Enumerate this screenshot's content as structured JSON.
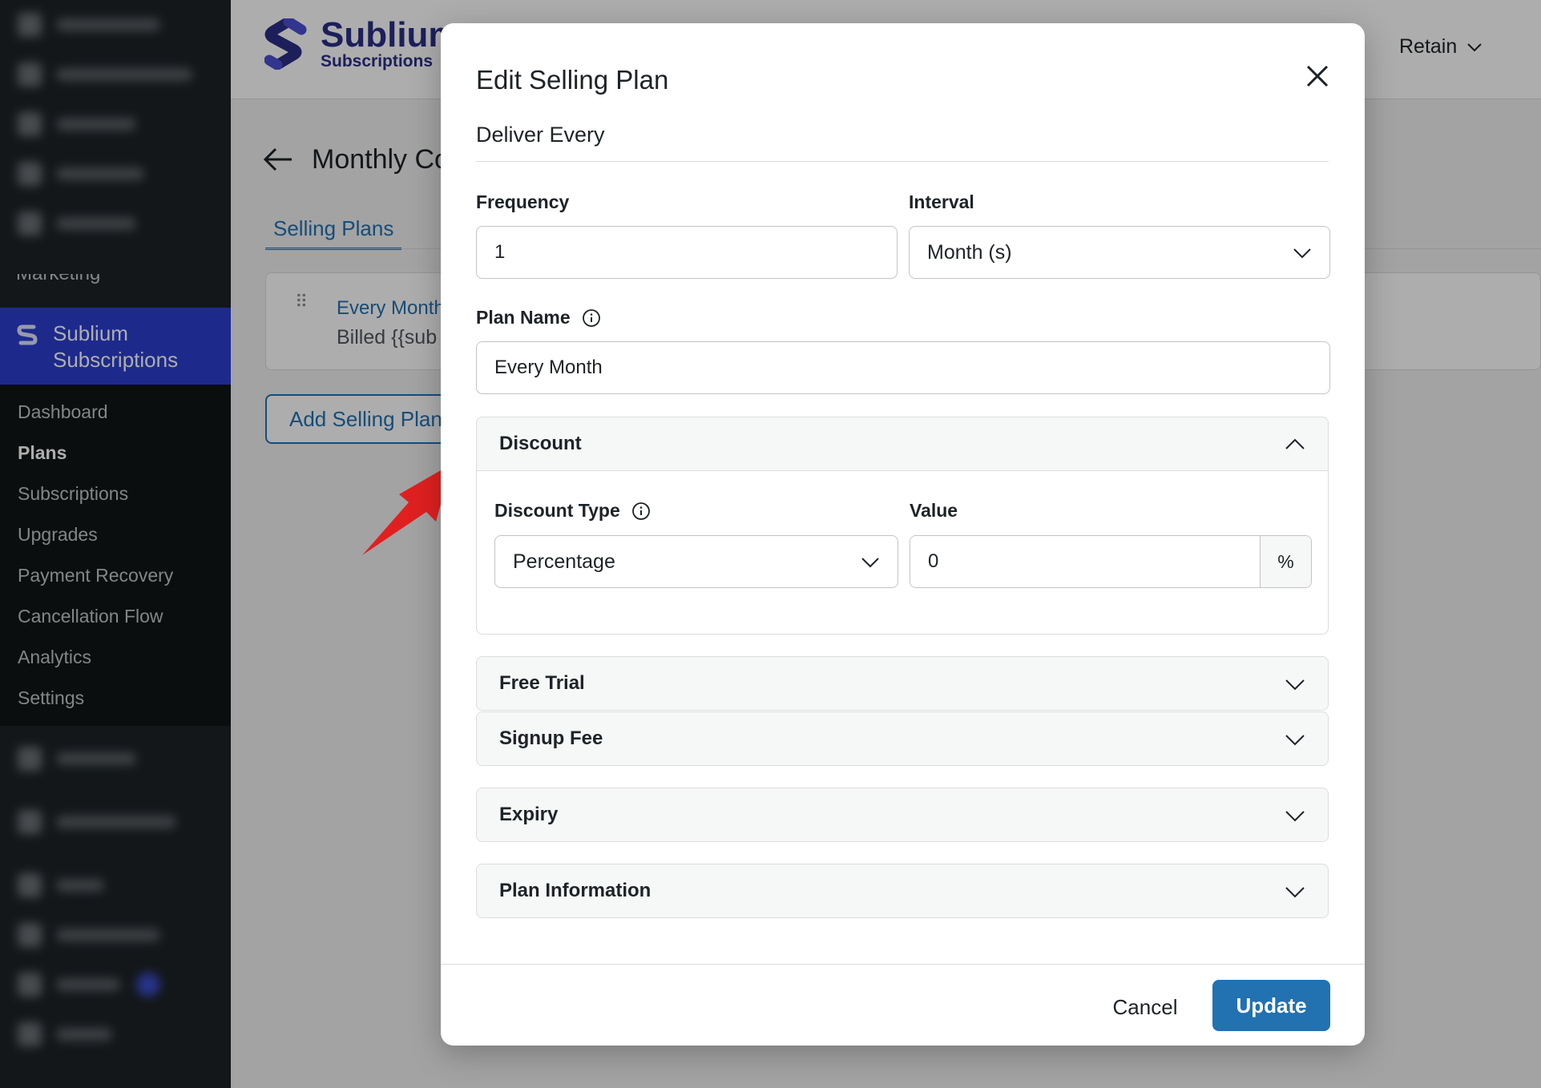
{
  "sidebar": {
    "partial_item": "Marketing",
    "active_plugin": {
      "line1": "Sublium",
      "line2": "Subscriptions"
    },
    "submenu": [
      {
        "label": "Dashboard",
        "current": false
      },
      {
        "label": "Plans",
        "current": true
      },
      {
        "label": "Subscriptions",
        "current": false
      },
      {
        "label": "Upgrades",
        "current": false
      },
      {
        "label": "Payment Recovery",
        "current": false
      },
      {
        "label": "Cancellation Flow",
        "current": false
      },
      {
        "label": "Analytics",
        "current": false
      },
      {
        "label": "Settings",
        "current": false
      }
    ]
  },
  "header": {
    "brand_name": "Sublium",
    "brand_sub": "Subscriptions",
    "menu_retain": "Retain"
  },
  "page": {
    "title": "Monthly Co",
    "tab_label": "Selling Plans",
    "plan_card_title": "Every Month",
    "plan_card_sub": "Billed {{sub",
    "add_button": "Add Selling Plan"
  },
  "modal": {
    "title": "Edit Selling Plan",
    "section_heading": "Deliver Every",
    "frequency": {
      "label": "Frequency",
      "value": "1"
    },
    "interval": {
      "label": "Interval",
      "value": "Month (s)"
    },
    "plan_name": {
      "label": "Plan Name",
      "value": "Every Month"
    },
    "discount": {
      "header": "Discount",
      "type_label": "Discount Type",
      "type_value": "Percentage",
      "value_label": "Value",
      "value": "0",
      "suffix": "%"
    },
    "sections": {
      "free_trial": "Free Trial",
      "signup_fee": "Signup Fee",
      "expiry": "Expiry",
      "plan_information": "Plan Information"
    },
    "footer": {
      "cancel": "Cancel",
      "update": "Update"
    }
  },
  "colors": {
    "accent_blue": "#2271b1",
    "plugin_active": "#2c3fcf",
    "brand": "#2b2f87",
    "annotation_red": "#e02020"
  }
}
